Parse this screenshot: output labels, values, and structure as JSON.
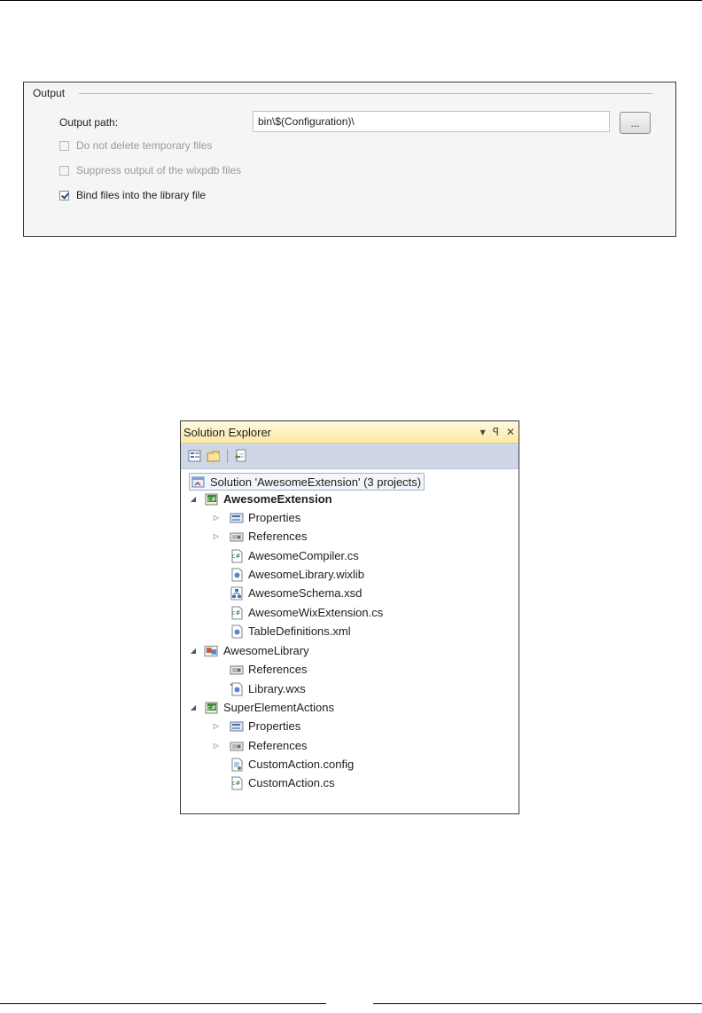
{
  "output_panel": {
    "legend": "Output",
    "output_path_label": "Output path:",
    "output_path_value": "bin\\$(Configuration)\\",
    "browse_label": "...",
    "options": [
      {
        "label": "Do not delete temporary files",
        "checked": false,
        "enabled": false
      },
      {
        "label": "Suppress output of the wixpdb files",
        "checked": false,
        "enabled": false
      },
      {
        "label": "Bind files into the library file",
        "checked": true,
        "enabled": true
      }
    ]
  },
  "solution_explorer": {
    "title": "Solution Explorer",
    "title_buttons": {
      "dropdown": "▾",
      "pin": "ꟼ",
      "close": "✕"
    },
    "toolbar": [
      {
        "icon": "properties-icon"
      },
      {
        "icon": "show-all-files-icon"
      },
      {
        "icon": "refresh-icon"
      }
    ],
    "tree": [
      {
        "label": "Solution 'AwesomeExtension' (3 projects)",
        "icon": "solution-icon",
        "expander": ""
      },
      {
        "label": "AwesomeExtension",
        "icon": "csharp-project-icon",
        "expander": "◢",
        "bold": true
      },
      {
        "label": "Properties",
        "icon": "properties-folder-icon",
        "expander": "▷"
      },
      {
        "label": "References",
        "icon": "references-folder-icon",
        "expander": "▷"
      },
      {
        "label": "AwesomeCompiler.cs",
        "icon": "csharp-file-icon",
        "expander": ""
      },
      {
        "label": "AwesomeLibrary.wixlib",
        "icon": "wix-file-icon",
        "expander": ""
      },
      {
        "label": "AwesomeSchema.xsd",
        "icon": "xsd-file-icon",
        "expander": ""
      },
      {
        "label": "AwesomeWixExtension.cs",
        "icon": "csharp-file-icon",
        "expander": ""
      },
      {
        "label": "TableDefinitions.xml",
        "icon": "xml-file-icon",
        "expander": ""
      },
      {
        "label": "AwesomeLibrary",
        "icon": "wix-project-icon",
        "expander": "◢"
      },
      {
        "label": "References",
        "icon": "references-folder-icon",
        "expander": ""
      },
      {
        "label": "Library.wxs",
        "icon": "wxs-file-icon",
        "expander": ""
      },
      {
        "label": "SuperElementActions",
        "icon": "csharp-project-icon",
        "expander": "◢"
      },
      {
        "label": "Properties",
        "icon": "properties-folder-icon",
        "expander": "▷"
      },
      {
        "label": "References",
        "icon": "references-folder-icon",
        "expander": "▷"
      },
      {
        "label": "CustomAction.config",
        "icon": "config-file-icon",
        "expander": ""
      },
      {
        "label": "CustomAction.cs",
        "icon": "csharp-file-icon",
        "expander": ""
      }
    ]
  }
}
